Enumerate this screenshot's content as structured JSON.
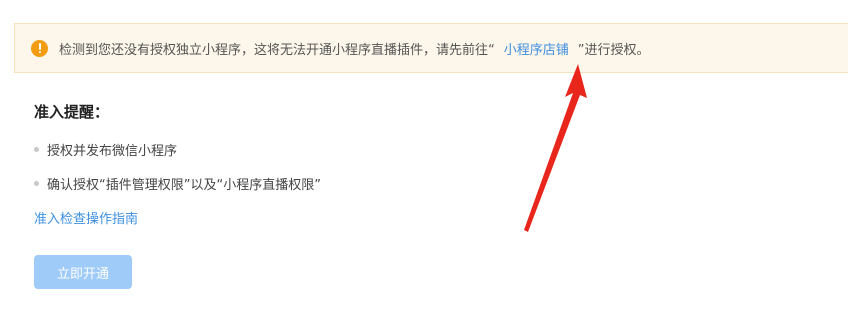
{
  "notice": {
    "icon": "warning-icon",
    "text_before": "检测到您还没有授权独立小程序，这将无法开通小程序直播插件，请先前往“",
    "link_label": "小程序店铺",
    "text_after": "”进行授权。"
  },
  "reminder": {
    "title": "准入提醒：",
    "items": [
      "授权并发布微信小程序",
      "确认授权“插件管理权限”以及“小程序直播权限”"
    ],
    "guide_link": "准入检查操作指南"
  },
  "activate_button": {
    "label": "立即开通"
  },
  "colors": {
    "accent": "#3d8fe0",
    "warning": "#f39c12",
    "button_disabled": "#9fcbf8",
    "annotation_arrow": "#e8261c"
  }
}
